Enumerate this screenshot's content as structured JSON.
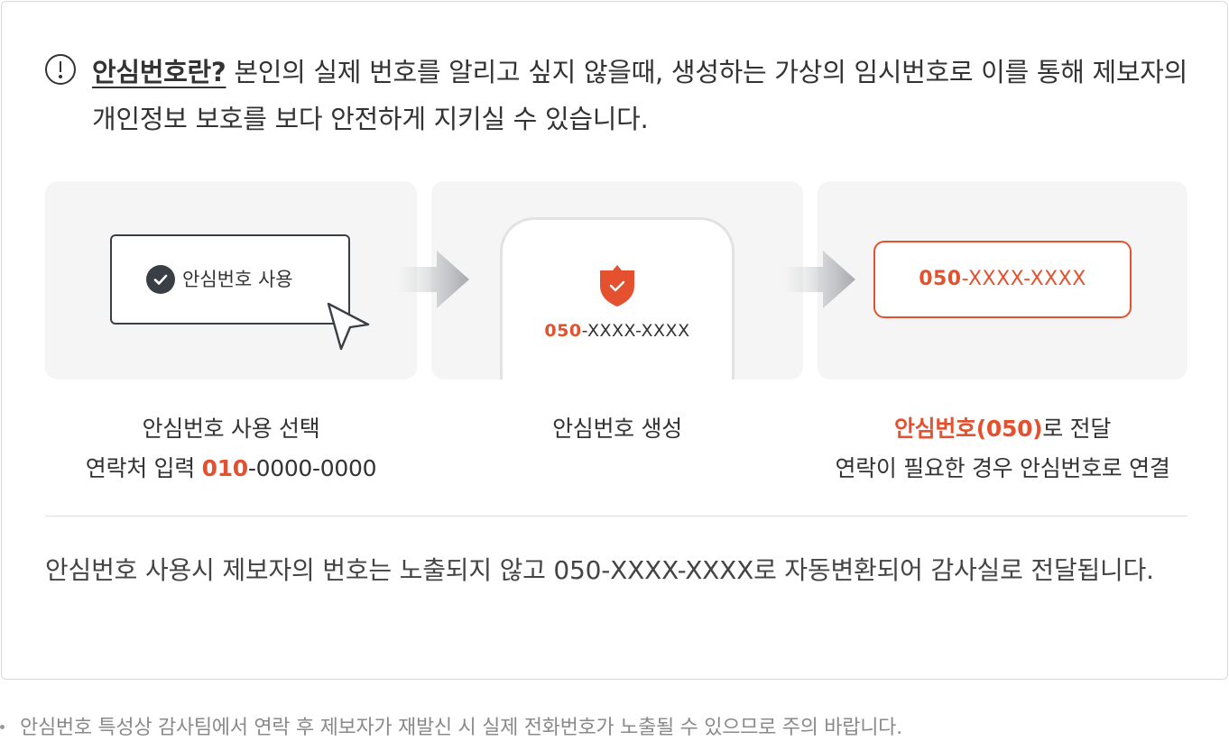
{
  "intro": {
    "icon": "info-circle-icon",
    "term": "안심번호란?",
    "text": " 본인의 실제 번호를 알리고 싶지 않을때, 생성하는 가상의 임시번호로 이를 통해 제보자의 개인정보 보호를 보다 안전하게 지키실 수 있습니다."
  },
  "steps": [
    {
      "option_label": "안심번호 사용",
      "caption_line1": "안심번호 사용 선택",
      "caption_line2_prefix": "연락처 입력 ",
      "caption_line2_accent": "010",
      "caption_line2_suffix": "-0000-0000"
    },
    {
      "number_accent": "050",
      "number_rest": "-XXXX-XXXX",
      "caption_line1": "안심번호 생성"
    },
    {
      "number_accent": "050",
      "number_rest": "-XXXX-XXXX",
      "caption_line1_accent": "안심번호(050)",
      "caption_line1_suffix": "로 전달",
      "caption_line2": "연락이 필요한 경우 안심번호로 연결"
    }
  ],
  "summary": "안심번호 사용시 제보자의 번호는 노출되지 않고 050-XXXX-XXXX로 자동변환되어 감사실로 전달됩니다.",
  "footnote": "안심번호 특성상 감사팀에서 연락 후 제보자가 재발신 시 실제 전화번호가 노출될 수 있으므로 주의 바랍니다.",
  "colors": {
    "accent": "#e4512e",
    "dark": "#3a3f45",
    "card_bg": "#f5f5f5",
    "text": "#333333",
    "muted": "#8a8a8a"
  }
}
